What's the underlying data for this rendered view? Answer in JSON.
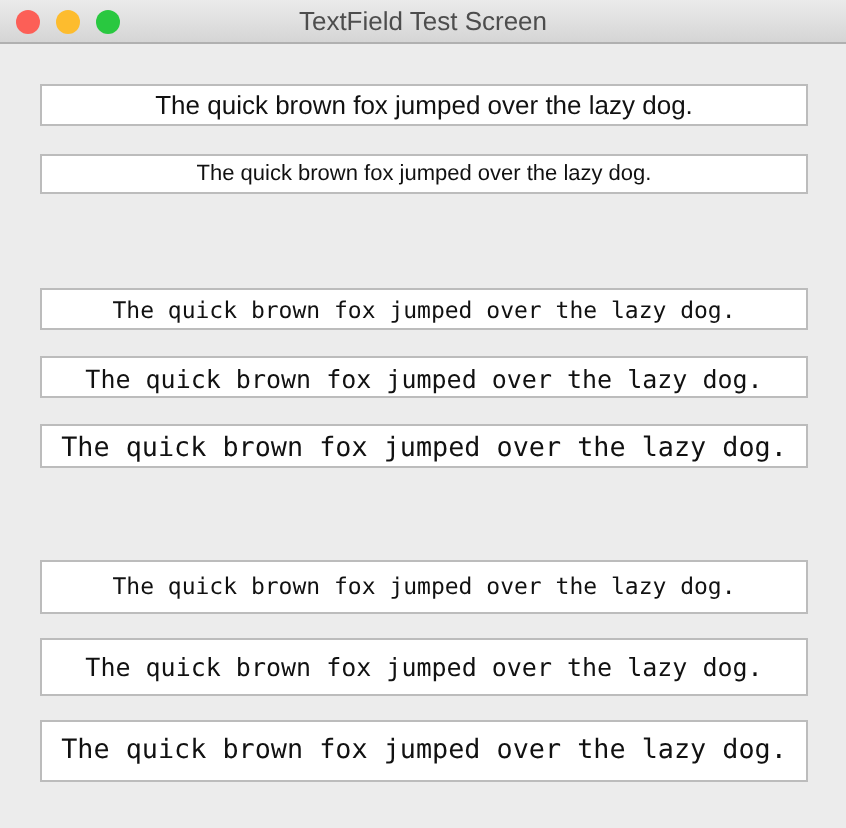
{
  "window": {
    "title": "TextField Test Screen"
  },
  "groups": [
    {
      "kind": "sans",
      "fields": [
        {
          "value": "The quick brown fox jumped over the lazy dog."
        },
        {
          "value": "The quick brown fox jumped over the lazy dog."
        }
      ]
    },
    {
      "kind": "mono-tight",
      "fields": [
        {
          "value": "The quick brown fox jumped over the lazy dog."
        },
        {
          "value": "The quick brown fox jumped over the lazy dog."
        },
        {
          "value": "The quick brown fox jumped over the lazy dog."
        }
      ]
    },
    {
      "kind": "mono",
      "fields": [
        {
          "value": "The quick brown fox jumped over the lazy dog."
        },
        {
          "value": "The quick brown fox jumped over the lazy dog."
        },
        {
          "value": "The quick brown fox jumped over the lazy dog."
        }
      ]
    }
  ]
}
